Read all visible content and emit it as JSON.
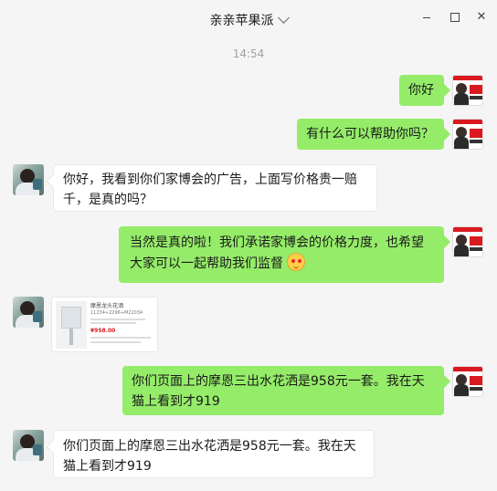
{
  "window": {
    "title": "亲亲苹果派",
    "controls": {
      "minimize_icon": "minimize-icon",
      "maximize_icon": "maximize-icon",
      "close_icon": "close-icon",
      "close_glyph": "✕"
    }
  },
  "timestamp": "14:54",
  "messages": [
    {
      "side": "sent",
      "text": "你好"
    },
    {
      "side": "sent",
      "text": "有什么可以帮助你吗？"
    },
    {
      "side": "received",
      "text": "你好，我看到你们家博会的广告，上面写价格贵一赔千，是真的吗？"
    },
    {
      "side": "sent",
      "text": "当然是真的啦！我们承诺家博会的价格力度，也希望大家可以一起帮助我们监督",
      "emoji": "blush-emoji"
    },
    {
      "side": "received",
      "type": "product-card",
      "product": {
        "name": "摩恩龙头花洒",
        "model": "11234+2296+M22034",
        "price": "¥958.00"
      }
    },
    {
      "side": "sent",
      "text": "你们页面上的摩恩三出水花洒是958元一套。我在天猫上看到才919"
    },
    {
      "side": "received",
      "text": "你们页面上的摩恩三出水花洒是958元一套。我在天猫上看到才919"
    }
  ]
}
